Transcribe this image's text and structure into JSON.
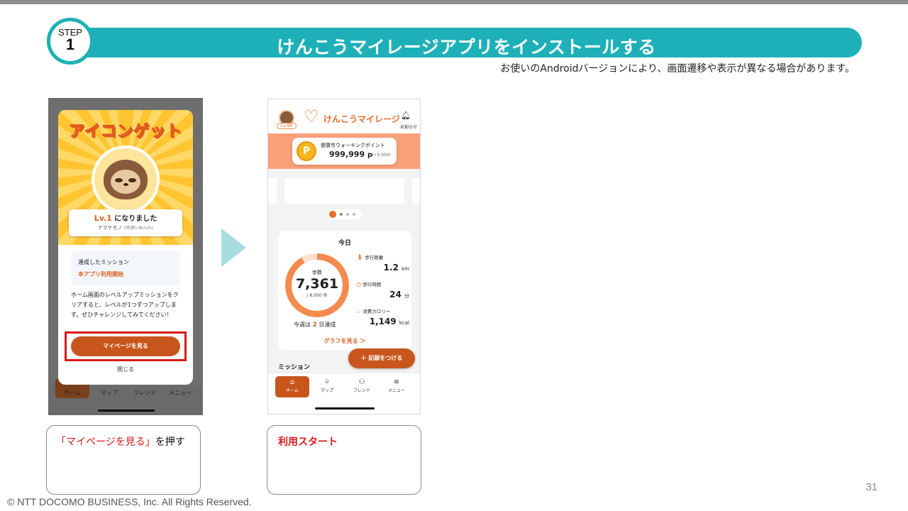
{
  "header": {
    "step_label": "STEP",
    "step_number": "1",
    "title": "けんこうマイレージアプリをインストールする",
    "note": "お使いのAndroidバージョンにより、画面遷移や表示が異なる場合があります。"
  },
  "screen1": {
    "modal_heading": "アイコンゲット",
    "level_prefix": "Lv.1",
    "level_suffix": " になりました",
    "character_name": "ナマケモノ",
    "character_speed": "(時速0.8km/h)",
    "mission_title": "達成したミッション",
    "mission_value": "本アプリ利用開始",
    "description": "ホーム画面のレベルアップミッションをクリアすると、レベルが1つずつアップします。ぜひチャレンジしてみてください！",
    "mypage_button": "マイページを見る",
    "close_link": "閉じる",
    "bg_nav": [
      "ホーム",
      "マップ",
      "フレンド",
      "メニュー"
    ]
  },
  "screen2": {
    "level_badge": "Lv.99",
    "app_title": "けんこうマイレージ",
    "bell_label": "お知らせ",
    "points_label": "健康市ウォーキングポイント",
    "points_value": "999,999",
    "points_unit": "p",
    "points_delta": "(+9,999)",
    "coin_letter": "P",
    "today_title": "今日",
    "steps_label": "歩数",
    "steps_value": "7,361",
    "steps_goal": "/ 8,000 歩",
    "steps_progress": 0.92,
    "week_prefix": "今週は",
    "week_days": "2",
    "week_suffix": "日達成",
    "graph_link": "グラフを見る ＞",
    "stats": [
      {
        "icon": "🚶",
        "label": "歩行距離",
        "value": "1.2",
        "unit": "km"
      },
      {
        "icon": "◷",
        "label": "歩行時間",
        "value": "24",
        "unit": "分"
      },
      {
        "icon": "♨",
        "label": "消費カロリー",
        "value": "1,149",
        "unit": "kcal"
      }
    ],
    "record_button": "＋ 記録をつける",
    "mission_heading": "ミッション",
    "nav": [
      {
        "icon": "⌂",
        "label": "ホーム"
      },
      {
        "icon": "⌾",
        "label": "マップ"
      },
      {
        "icon": "⚇",
        "label": "フレンド"
      },
      {
        "icon": "≡",
        "label": "メニュー"
      }
    ]
  },
  "captions": {
    "caption1_highlight": "「マイページを見る」",
    "caption1_rest": "を押す",
    "caption2": "利用スタート"
  },
  "footer": {
    "page_number": "31",
    "copyright": "© NTT DOCOMO BUSINESS, Inc. All Rights Reserved."
  },
  "colors": {
    "teal": "#1eb0b8",
    "orange": "#c8561c",
    "red": "#d61a1a"
  }
}
